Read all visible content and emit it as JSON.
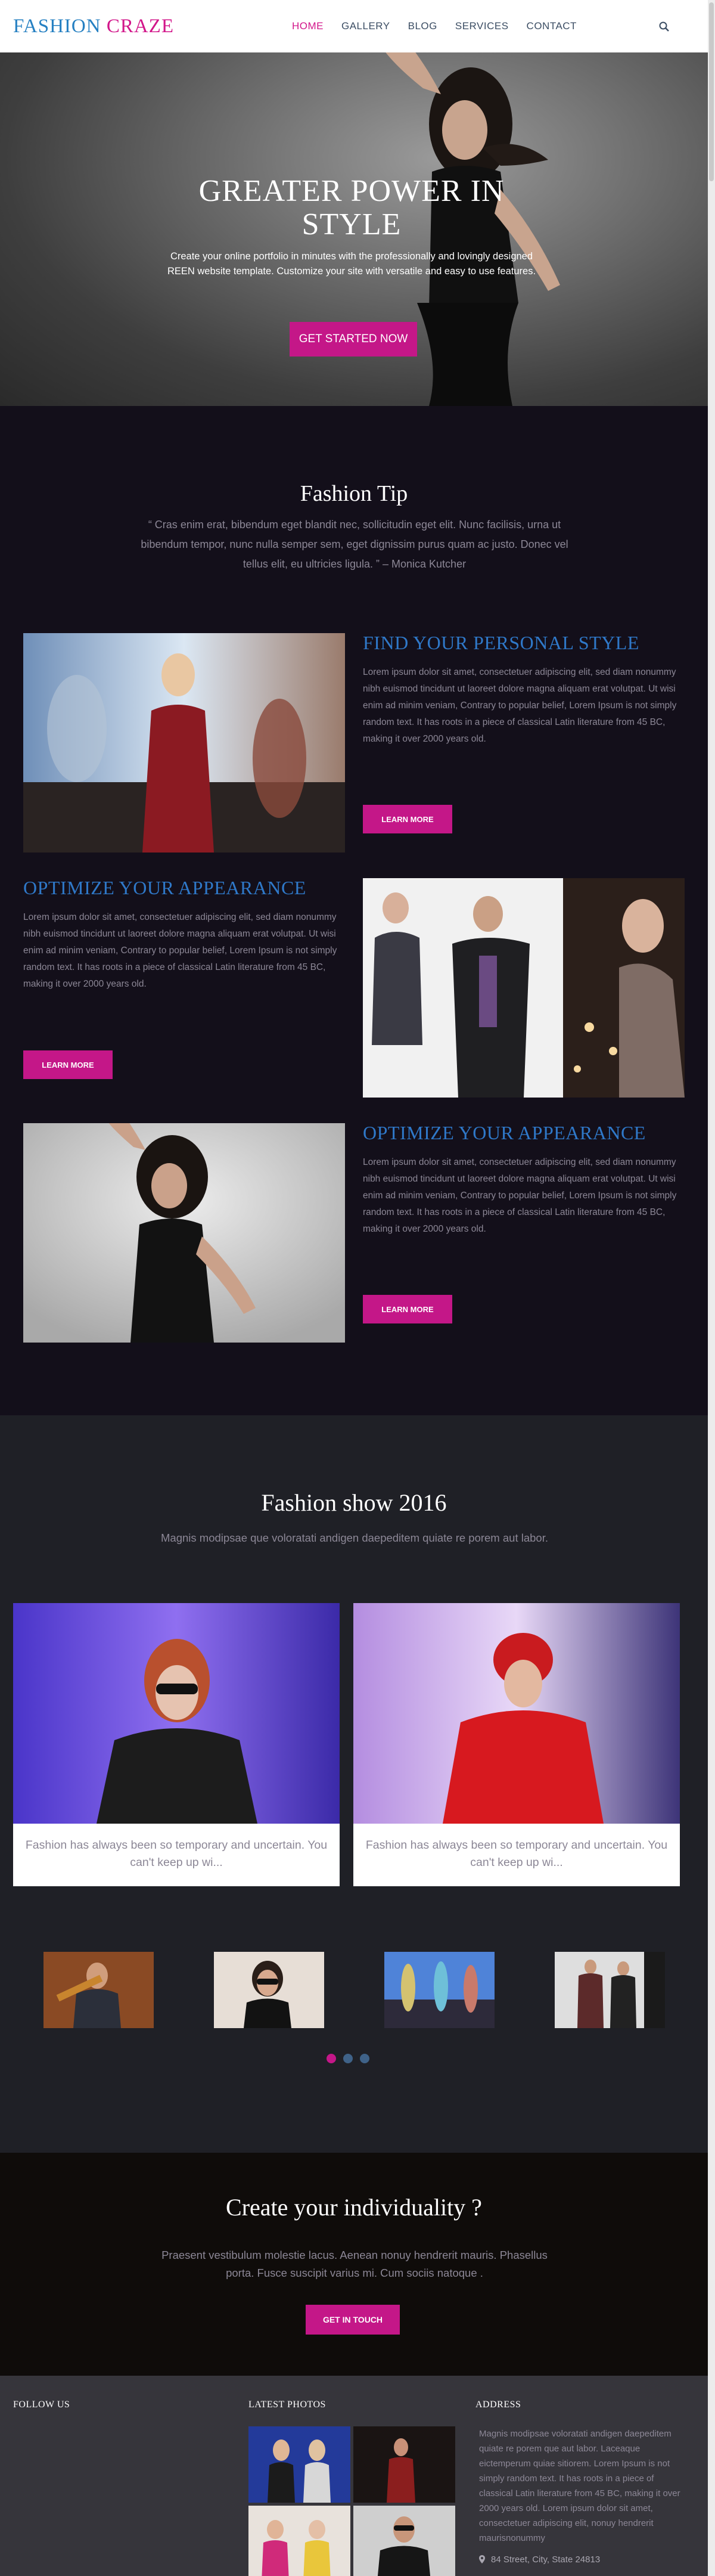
{
  "header": {
    "logo_part1": "FASHION",
    "logo_part2": "CRAZE",
    "nav": [
      "HOME",
      "GALLERY",
      "BLOG",
      "SERVICES",
      "CONTACT"
    ]
  },
  "hero": {
    "title": "GREATER POWER IN STYLE",
    "subtitle": "Create your online portfolio in minutes with the professionally and lovingly designed REEN website template. Customize your site with versatile and easy to use features.",
    "cta": "GET STARTED NOW"
  },
  "tip": {
    "title": "Fashion Tip",
    "quote": "“ Cras enim erat, bibendum eget blandit nec, sollicitudin eget elit. Nunc facilisis, urna ut bibendum tempor, nunc nulla semper sem, eget dignissim purus quam ac justo. Donec vel tellus elit, eu ultricies ligula. ” – Monica Kutcher",
    "rows": [
      {
        "heading": "FIND YOUR PERSONAL STYLE",
        "text": "Lorem ipsum dolor sit amet, consectetuer adipiscing elit, sed diam nonummy nibh euismod tincidunt ut laoreet dolore magna aliquam erat volutpat. Ut wisi enim ad minim veniam, Contrary to popular belief, Lorem Ipsum is not simply random text. It has roots in a piece of classical Latin literature from 45 BC, making it over 2000 years old.",
        "button": "LEARN MORE"
      },
      {
        "heading": "OPTIMIZE YOUR APPEARANCE",
        "text": "Lorem ipsum dolor sit amet, consectetuer adipiscing elit, sed diam nonummy nibh euismod tincidunt ut laoreet dolore magna aliquam erat volutpat. Ut wisi enim ad minim veniam, Contrary to popular belief, Lorem Ipsum is not simply random text. It has roots in a piece of classical Latin literature from 45 BC, making it over 2000 years old.",
        "button": "LEARN MORE"
      },
      {
        "heading": "OPTIMIZE YOUR APPEARANCE",
        "text": "Lorem ipsum dolor sit amet, consectetuer adipiscing elit, sed diam nonummy nibh euismod tincidunt ut laoreet dolore magna aliquam erat volutpat. Ut wisi enim ad minim veniam, Contrary to popular belief, Lorem Ipsum is not simply random text. It has roots in a piece of classical Latin literature from 45 BC, making it over 2000 years old.",
        "button": "LEARN MORE"
      }
    ]
  },
  "show": {
    "title": "Fashion show 2016",
    "subtitle": "Magnis modipsae que voloratati andigen daepeditem quiate re porem aut labor.",
    "cards": [
      {
        "caption": "Fashion has always been so temporary and uncertain. You can't keep up wi..."
      },
      {
        "caption": "Fashion has always been so temporary and uncertain. You can't keep up wi..."
      }
    ],
    "dots_active": 0
  },
  "cta": {
    "title": "Create your individuality ?",
    "subtitle": "Praesent vestibulum molestie lacus. Aenean nonuy hendrerit mauris. Phasellus porta. Fusce suscipit varius mi. Cum sociis natoque .",
    "button": "GET IN TOUCH"
  },
  "footer": {
    "follow_heading": "FOLLOW US",
    "photos_heading": "LATEST PHOTOS",
    "address_heading": "ADDRESS",
    "address_text": "Magnis modipsae voloratati andigen daepeditem quiate re porem que aut labor. Laceaque eictemperum quiae sitiorem. Lorem Ipsum is not simply random text. It has roots in a piece of classical Latin literature from 45 BC, making it over 2000 years old. Lorem ipsum dolor sit amet, consectetuer adipiscing elit, nonuy hendrerit maurisnonummy",
    "location": "84 Street, City, State 24813"
  },
  "colors": {
    "accent": "#c41788",
    "heading_blue": "#2f78c8",
    "logo_blue": "#2680c2"
  }
}
